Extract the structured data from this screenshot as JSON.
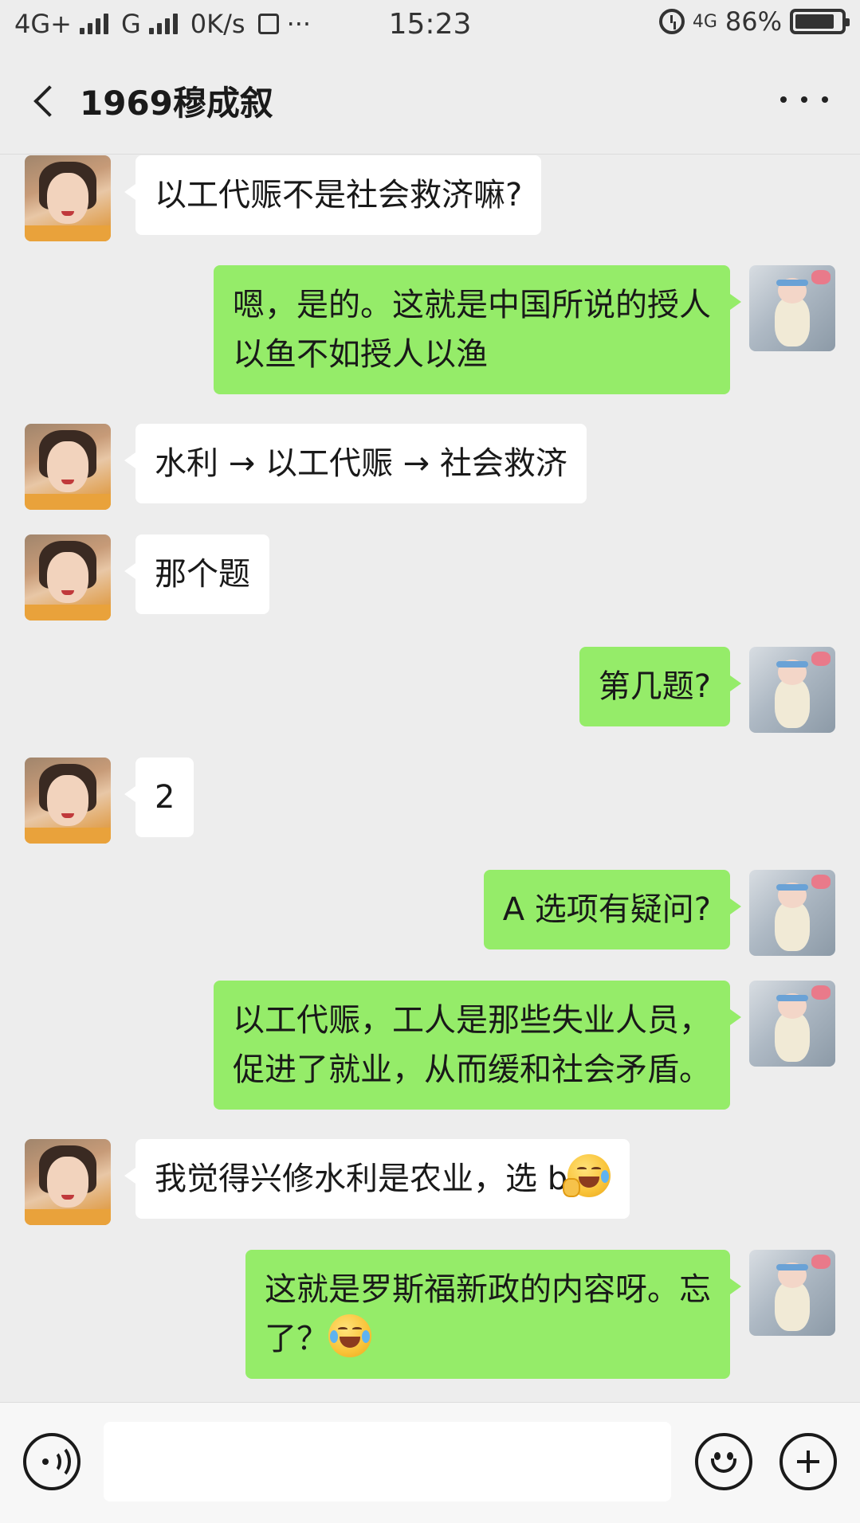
{
  "status_bar": {
    "network_1": "4G+",
    "network_2": "G",
    "speed": "0K/s",
    "more": "···",
    "time": "15:23",
    "network_3": "4G",
    "battery_level": "86%"
  },
  "header": {
    "title": "1969穆成叙"
  },
  "messages": [
    {
      "side": "left",
      "text": "以工代赈不是社会救济嘛?"
    },
    {
      "side": "right",
      "text": "嗯，是的。这就是中国所说的授人\n以鱼不如授人以渔"
    },
    {
      "side": "left",
      "text": "水利 → 以工代赈 → 社会救济"
    },
    {
      "side": "left",
      "text": "那个题"
    },
    {
      "side": "right",
      "text": "第几题?"
    },
    {
      "side": "left",
      "text": "2"
    },
    {
      "side": "right",
      "text": "A 选项有疑问?"
    },
    {
      "side": "right",
      "text": "以工代赈，工人是那些失业人员，\n促进了就业，从而缓和社会矛盾。"
    },
    {
      "side": "left",
      "text": "我觉得兴修水利是农业，选 b",
      "emoji": "face-with-hand-over-mouth-laughing"
    },
    {
      "side": "right",
      "text": "这就是罗斯福新政的内容呀。忘\n了？",
      "emoji": "face-with-tears-of-joy"
    }
  ],
  "input_bar": {
    "placeholder": ""
  },
  "colors": {
    "background": "#ededed",
    "sent_bubble": "#95ec69",
    "received_bubble": "#ffffff"
  }
}
